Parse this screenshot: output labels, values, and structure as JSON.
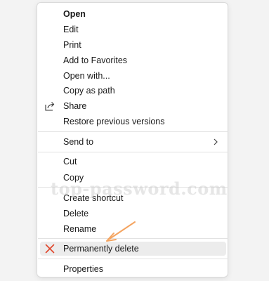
{
  "menu": {
    "open": "Open",
    "edit": "Edit",
    "print": "Print",
    "add_to_favorites": "Add to Favorites",
    "open_with": "Open with...",
    "copy_as_path": "Copy as path",
    "share": "Share",
    "restore_previous_versions": "Restore previous versions",
    "send_to": "Send to",
    "cut": "Cut",
    "copy": "Copy",
    "create_shortcut": "Create shortcut",
    "delete": "Delete",
    "rename": "Rename",
    "permanently_delete": "Permanently delete",
    "properties": "Properties"
  },
  "watermark": "top-password.com",
  "colors": {
    "delete_x": "#e0452a",
    "arrow": "#f4a460",
    "highlight": "#ececec"
  },
  "icons": {
    "share": "share-icon",
    "send_to_chevron": "chevron-right-icon",
    "permanently_delete": "close-x-icon",
    "annotation": "arrow-icon"
  }
}
